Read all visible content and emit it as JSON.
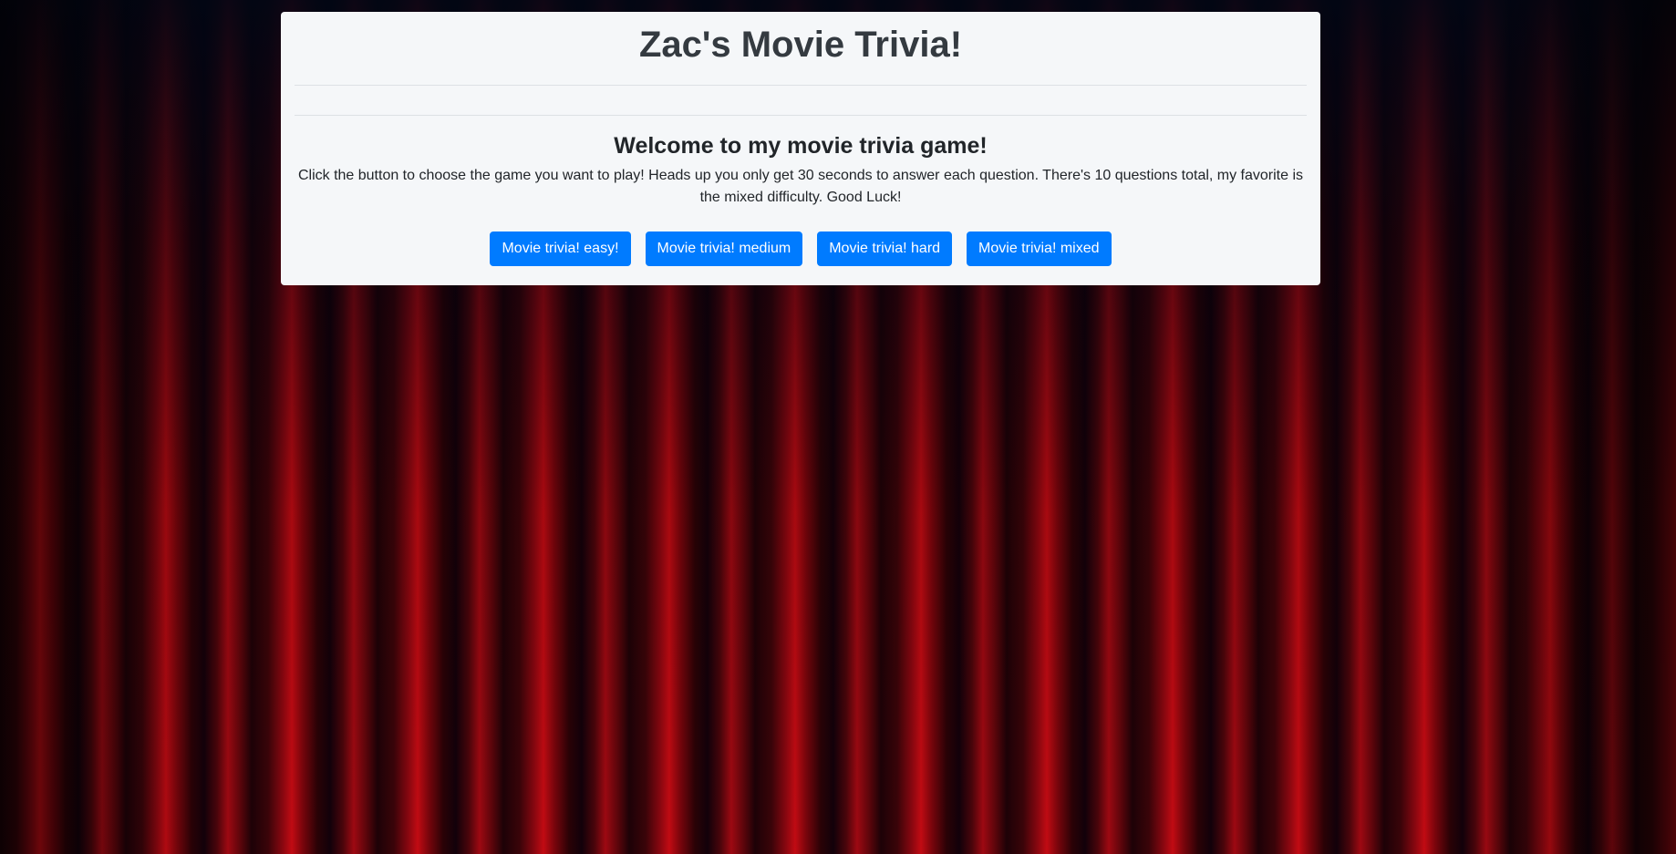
{
  "page": {
    "title": "Zac's Movie Trivia!",
    "welcome_heading": "Welcome to my movie trivia game!",
    "intro_text": "Click the button to choose the game you want to play! Heads up you only get 30 seconds to answer each question. There's 10 questions total, my favorite is the mixed difficulty. Good Luck!"
  },
  "buttons": [
    {
      "label": "Movie trivia! easy!"
    },
    {
      "label": "Movie trivia! medium"
    },
    {
      "label": "Movie trivia! hard"
    },
    {
      "label": "Movie trivia! mixed"
    }
  ],
  "colors": {
    "button_background": "#007bff",
    "card_background": "#f5f7f9",
    "curtain": "#c20b13"
  }
}
